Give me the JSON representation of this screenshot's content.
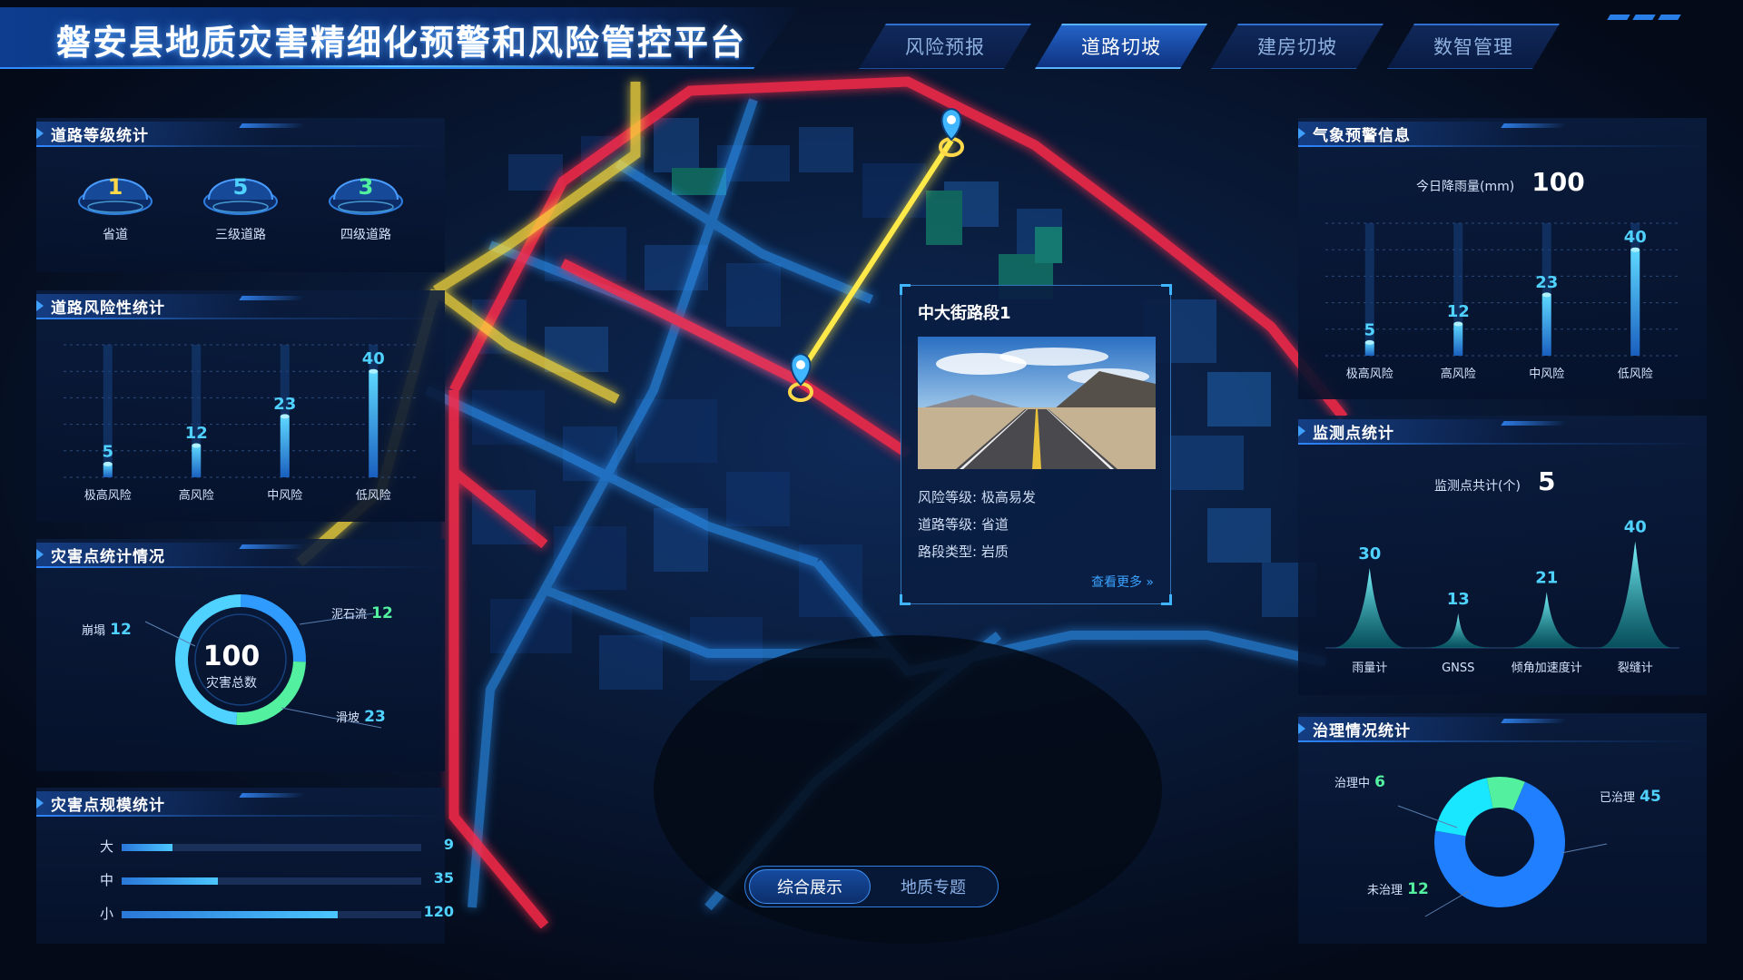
{
  "header": {
    "title": "磐安县地质灾害精细化预警和风险管控平台",
    "nav": [
      {
        "label": "风险预报",
        "active": false
      },
      {
        "label": "道路切坡",
        "active": true
      },
      {
        "label": "建房切坡",
        "active": false
      },
      {
        "label": "数智管理",
        "active": false
      }
    ]
  },
  "left": {
    "road_grade": {
      "title": "道路等级统计",
      "items": [
        {
          "value": "1",
          "label": "省道",
          "color": "#ffd84a"
        },
        {
          "value": "5",
          "label": "三级道路",
          "color": "#4fd2ff"
        },
        {
          "value": "3",
          "label": "四级道路",
          "color": "#53f0a0"
        }
      ]
    },
    "road_risk": {
      "title": "道路风险性统计"
    },
    "hazard_points": {
      "title": "灾害点统计情况",
      "total_value": "100",
      "total_label": "灾害总数",
      "collapse_label": "崩塌",
      "collapse_value": "12",
      "debris_label": "泥石流",
      "debris_value": "12",
      "landslide_label": "滑坡",
      "landslide_value": "23"
    },
    "hazard_scale": {
      "title": "灾害点规模统计",
      "rows": [
        {
          "label": "大",
          "value": "9",
          "fill": 0.17
        },
        {
          "label": "中",
          "value": "35",
          "fill": 0.32
        },
        {
          "label": "小",
          "value": "120",
          "fill": 0.72
        }
      ]
    }
  },
  "right": {
    "weather": {
      "title": "气象预警信息",
      "rain_label": "今日降雨量(mm)",
      "rain_value": "100"
    },
    "monitor": {
      "title": "监测点统计",
      "total_label": "监测点共计(个)",
      "total_value": "5"
    },
    "governance": {
      "title": "治理情况统计",
      "in_progress_label": "治理中",
      "in_progress_value": "6",
      "done_label": "已治理",
      "done_value": "45",
      "todo_label": "未治理",
      "todo_value": "12"
    }
  },
  "popup": {
    "title": "中大街路段1",
    "risk_label": "风险等级:",
    "risk_value": "极高易发",
    "grade_label": "道路等级:",
    "grade_value": "省道",
    "type_label": "路段类型:",
    "type_value": "岩质",
    "more": "查看更多 »"
  },
  "mode_toggle": {
    "options": [
      "综合展示",
      "地质专题"
    ],
    "active": 0
  },
  "colors": {
    "accent": "#2f86ff",
    "cyan": "#4fd2ff",
    "road_red": "#ff2a4a",
    "road_yellow": "#ffe03a",
    "road_blue": "#2f9bff"
  },
  "chart_data": [
    {
      "id": "road_risk",
      "type": "bar",
      "categories": [
        "极高风险",
        "高风险",
        "中风险",
        "低风险"
      ],
      "values": [
        5,
        12,
        23,
        40
      ],
      "title": "道路风险性统计",
      "ylim": [
        0,
        50
      ],
      "grid": true
    },
    {
      "id": "weather_risk",
      "type": "bar",
      "categories": [
        "极高风险",
        "高风险",
        "中风险",
        "低风险"
      ],
      "values": [
        5,
        12,
        23,
        40
      ],
      "title": "气象预警信息",
      "ylim": [
        0,
        50
      ],
      "grid": true
    },
    {
      "id": "monitor_points",
      "type": "area",
      "categories": [
        "雨量计",
        "GNSS",
        "倾角加速度计",
        "裂缝计"
      ],
      "values": [
        30,
        13,
        21,
        40
      ],
      "title": "监测点统计",
      "ylim": [
        0,
        45
      ]
    },
    {
      "id": "hazard_types",
      "type": "pie",
      "labels": [
        "崩塌",
        "泥石流",
        "滑坡"
      ],
      "values": [
        12,
        12,
        23
      ],
      "title": "灾害点统计情况"
    },
    {
      "id": "governance",
      "type": "pie",
      "labels": [
        "治理中",
        "已治理",
        "未治理"
      ],
      "values": [
        6,
        45,
        12
      ],
      "title": "治理情况统计"
    }
  ]
}
